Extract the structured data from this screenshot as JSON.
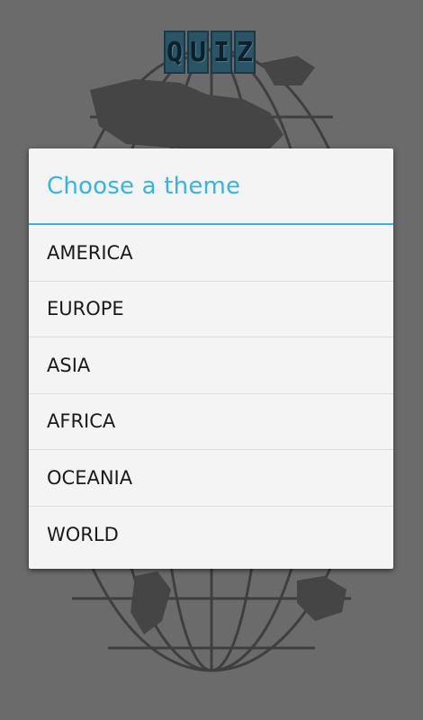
{
  "app": {
    "logo_letters": [
      "Q",
      "U",
      "I",
      "Z"
    ]
  },
  "dialog": {
    "title": "Choose a theme",
    "accent_color": "#33b5e5",
    "items": [
      {
        "label": "AMERICA"
      },
      {
        "label": "EUROPE"
      },
      {
        "label": "ASIA"
      },
      {
        "label": "AFRICA"
      },
      {
        "label": "OCEANIA"
      },
      {
        "label": "WORLD"
      }
    ]
  }
}
